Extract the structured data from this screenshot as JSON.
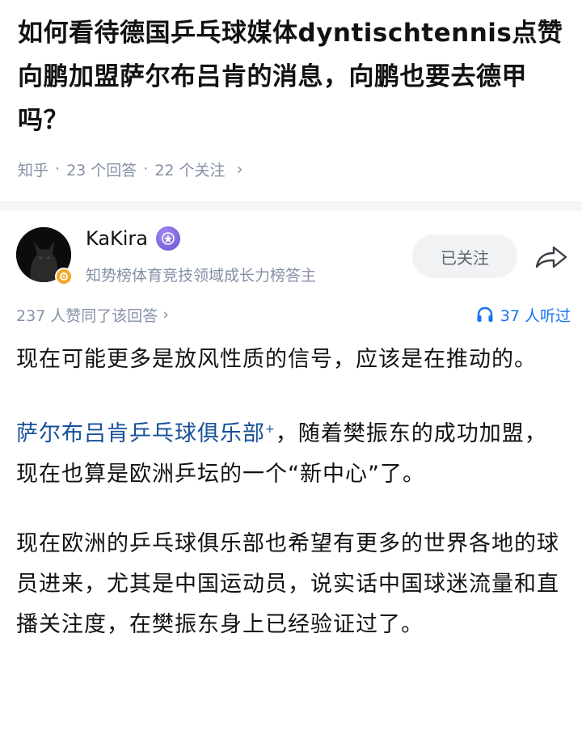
{
  "question": {
    "title": "如何看待德国乒乓球媒体dyntischtennis点赞向鹏加盟萨尔布吕肯的消息，向鹏也要去德甲吗？",
    "source": "知乎",
    "sep": "·",
    "answers": "23 个回答",
    "followers": "22 个关注",
    "chevron": "›"
  },
  "author": {
    "name": "KaKira",
    "description": "知势榜体育竞技领域成长力榜答主",
    "follow_label": "已关注",
    "avatar_icon": "cat-silhouette-icon",
    "badge_icon": "gear-badge-icon",
    "vip_icon": "vip-badge-icon"
  },
  "stats": {
    "likes": "237 人赞同了该回答",
    "likes_chevron": "›",
    "listens": "37 人听过",
    "listen_icon": "headphone-icon"
  },
  "content": {
    "p1": "现在可能更多是放风性质的信号，应该是在推动的。",
    "p2_link": "萨尔布吕肯乒乓球俱乐部",
    "p2_link_mark": "+",
    "p2_text": "，随着樊振东的成功加盟，现在也算是欧洲乒坛的一个“新中心”了。",
    "p3": "现在欧洲的乒乓球俱乐部也希望有更多的世界各地的球员进来，尤其是中国运动员，说实话中国球迷流量和直播关注度，在樊振东身上已经验证过了。"
  },
  "colors": {
    "link": "#175199",
    "accent_blue": "#1772f6",
    "meta_gray": "#8590a6",
    "badge_orange": "#f5a524",
    "vip_purple": "#6a4fd0"
  }
}
